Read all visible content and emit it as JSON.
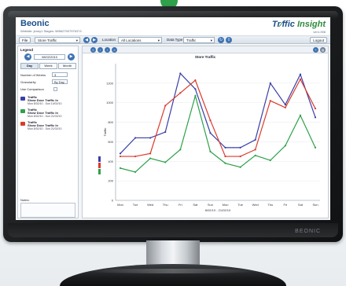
{
  "header": {
    "logo": "Beonic",
    "logo_sub": "Website: jenny1  Stages: 5856279079763?3",
    "product_a": "Tr",
    "product_b": "ffic",
    "product_c": " Insight",
    "version": "ver1.006"
  },
  "toolbar": {
    "file": "File",
    "view_select": "Store Traffic",
    "location_label": "Location",
    "location_select": "All Locations",
    "datatype_label": "Data Type",
    "datatype_select": "Traffic",
    "logout": "Logout"
  },
  "sidebar": {
    "title": "Legend",
    "date": "08/02/2010",
    "tabs": [
      "Day",
      "Week",
      "Month"
    ],
    "weeks_label": "Number of Weeks",
    "weeks_value": "3",
    "granularity_label": "Granularity",
    "granularity_value": "By Day",
    "comparison_label": "Use Comparison",
    "legend": [
      {
        "name": "Traffic",
        "sub": "Show Door Traffic In",
        "range": "Mon 8/02/10 - Sun 14/02/10",
        "color": "#3a3fa8"
      },
      {
        "name": "Traffic",
        "sub": "Show Door Traffic In",
        "range": "Mon 8/02/10 - Sun 21/02/10",
        "color": "#2ea14a"
      },
      {
        "name": "Traffic",
        "sub": "Show Door Traffic In",
        "range": "Mon 8/02/10 - Sun 21/02/10",
        "color": "#d93a2b"
      }
    ],
    "notes_label": "Notes:"
  },
  "chart_data": {
    "type": "line",
    "title": "Store Traffic",
    "ylabel": "Traffic",
    "x_caption": "8/02/10 - 21/02/10",
    "categories": [
      "Mon",
      "Tue",
      "Wed",
      "Thu",
      "Fri",
      "Sat",
      "Sun",
      "Mon",
      "Tue",
      "Wed",
      "Thu",
      "Fri",
      "Sat",
      "Sun"
    ],
    "ylim": [
      0,
      1400
    ],
    "yticks": [
      0,
      200,
      400,
      600,
      800,
      1000,
      1200
    ],
    "series": [
      {
        "color": "#3a3fa8",
        "values": [
          480,
          640,
          640,
          700,
          1300,
          1140,
          690,
          540,
          540,
          620,
          1200,
          980,
          1290,
          850
        ]
      },
      {
        "color": "#d93a2b",
        "values": [
          450,
          450,
          480,
          970,
          1100,
          1230,
          820,
          450,
          450,
          520,
          1020,
          950,
          1240,
          940
        ]
      },
      {
        "color": "#2ea14a",
        "values": [
          330,
          290,
          430,
          390,
          520,
          1070,
          500,
          380,
          340,
          460,
          410,
          560,
          870,
          540
        ]
      }
    ]
  },
  "monitor": {
    "brand": "BEONIC"
  }
}
